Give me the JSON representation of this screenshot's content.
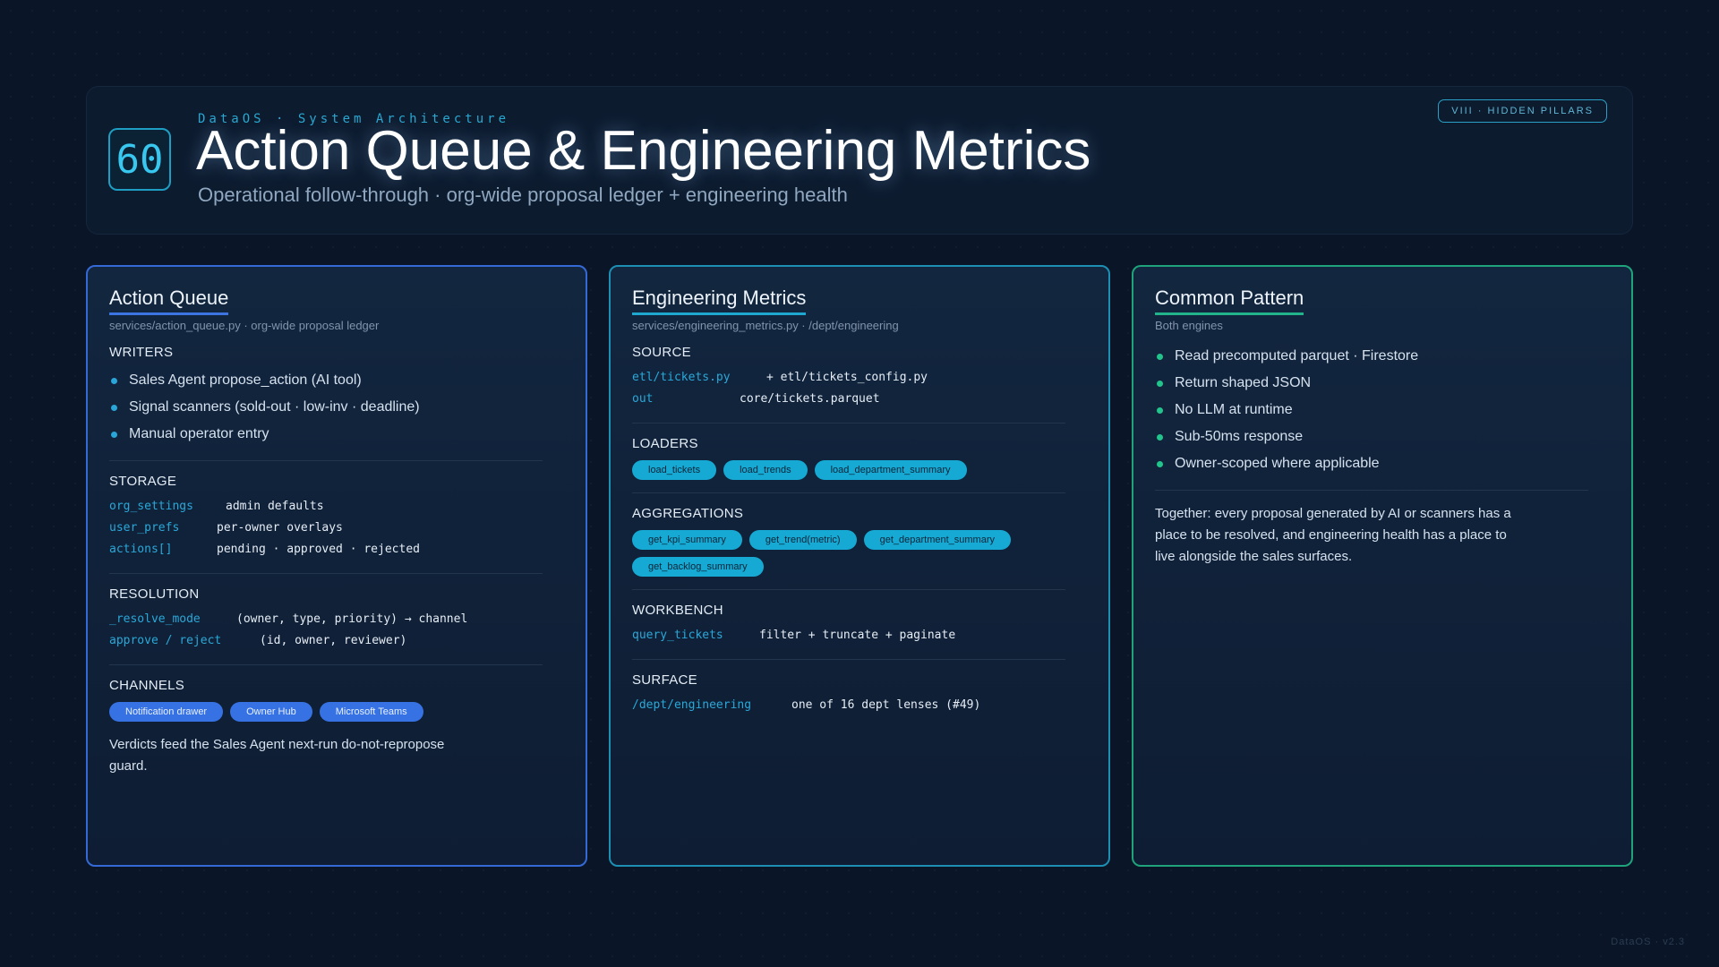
{
  "header": {
    "number": "60",
    "eyebrow": "DataOS · System Architecture",
    "title": "Action Queue & Engineering Metrics",
    "subtitle": "Operational follow-through · org-wide proposal ledger + engineering health",
    "tag": "VIII · HIDDEN PILLARS"
  },
  "action_queue": {
    "title": "Action Queue",
    "path": "services/action_queue.py · org-wide proposal ledger",
    "writers_label": "WRITERS",
    "writers": [
      "Sales Agent propose_action (AI tool)",
      "Signal scanners (sold-out · low-inv · deadline)",
      "Manual operator entry"
    ],
    "storage_label": "STORAGE",
    "storage": [
      {
        "key": "org_settings",
        "value": "admin defaults"
      },
      {
        "key": "user_prefs",
        "value": "per-owner overlays"
      },
      {
        "key": "actions[]",
        "value": "pending · approved · rejected"
      }
    ],
    "resolution_label": "RESOLUTION",
    "resolution": [
      {
        "key": "_resolve_mode",
        "value": "(owner, type, priority) → channel"
      },
      {
        "key": "approve / reject",
        "value": "(id, owner, reviewer)"
      }
    ],
    "channels_label": "CHANNELS",
    "channels": [
      "Notification drawer",
      "Owner Hub",
      "Microsoft Teams"
    ],
    "note": "Verdicts feed the Sales Agent next-run do-not-repropose guard."
  },
  "engineering": {
    "title": "Engineering Metrics",
    "path": "services/engineering_metrics.py · /dept/engineering",
    "source_label": "SOURCE",
    "source": [
      {
        "key": "etl/tickets.py",
        "value": "+ etl/tickets_config.py"
      },
      {
        "key": "out",
        "value": "core/tickets.parquet"
      }
    ],
    "loaders_label": "LOADERS",
    "loaders": [
      "load_tickets",
      "load_trends",
      "load_department_summary"
    ],
    "aggregations_label": "AGGREGATIONS",
    "aggregations": [
      "get_kpi_summary",
      "get_trend(metric)",
      "get_department_summary",
      "get_backlog_summary"
    ],
    "workbench_label": "WORKBENCH",
    "workbench": [
      {
        "key": "query_tickets",
        "value": "filter + truncate + paginate"
      }
    ],
    "surface_label": "SURFACE",
    "surface": [
      {
        "key": "/dept/engineering",
        "value": "one of 16 dept lenses (#49)"
      }
    ]
  },
  "common": {
    "title": "Common Pattern",
    "path": "Both engines",
    "items": [
      "Read precomputed parquet · Firestore",
      "Return shaped JSON",
      "No LLM at runtime",
      "Sub-50ms response",
      "Owner-scoped where applicable"
    ],
    "note": "Together: every proposal generated by AI or scanners has a place to be resolved, and engineering health has a place to live alongside the sales surfaces."
  },
  "footer": "DataOS · v2.3"
}
